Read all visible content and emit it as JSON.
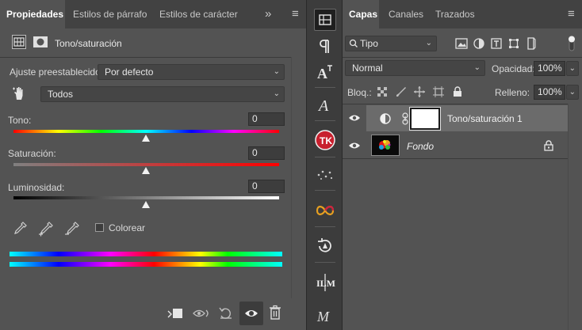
{
  "properties": {
    "tabs": [
      {
        "label": "Propiedades"
      },
      {
        "label": "Estilos de párrafo"
      },
      {
        "label": "Estilos de carácter"
      }
    ],
    "collapse_glyph": "»",
    "menu_glyph": "≡",
    "adjustment_title": "Tono/saturación",
    "preset_label": "Ajuste preestablecido:",
    "preset_value": "Por defecto",
    "channel_value": "Todos",
    "hue_label": "Tono:",
    "hue_value": "0",
    "saturation_label": "Saturación:",
    "saturation_value": "0",
    "lightness_label": "Luminosidad:",
    "lightness_value": "0",
    "colorize_label": "Colorear",
    "colorize_checked": false
  },
  "layers": {
    "tabs": [
      {
        "label": "Capas"
      },
      {
        "label": "Canales"
      },
      {
        "label": "Trazados"
      }
    ],
    "menu_glyph": "≡",
    "filter_kind": "Tipo",
    "blend_mode": "Normal",
    "opacity_label": "Opacidad:",
    "opacity_value": "100%",
    "lock_label": "Bloq.:",
    "fill_label": "Relleno:",
    "fill_value": "100%",
    "items": [
      {
        "name": "Tono/saturación 1",
        "selected": true
      },
      {
        "name": "Fondo",
        "selected": false,
        "locked": true
      }
    ]
  },
  "colors": {
    "panel_bg": "#535353",
    "tabbar_bg": "#424242",
    "selected_row": "#6b6b6b",
    "accent_tk": "#c8202e"
  }
}
